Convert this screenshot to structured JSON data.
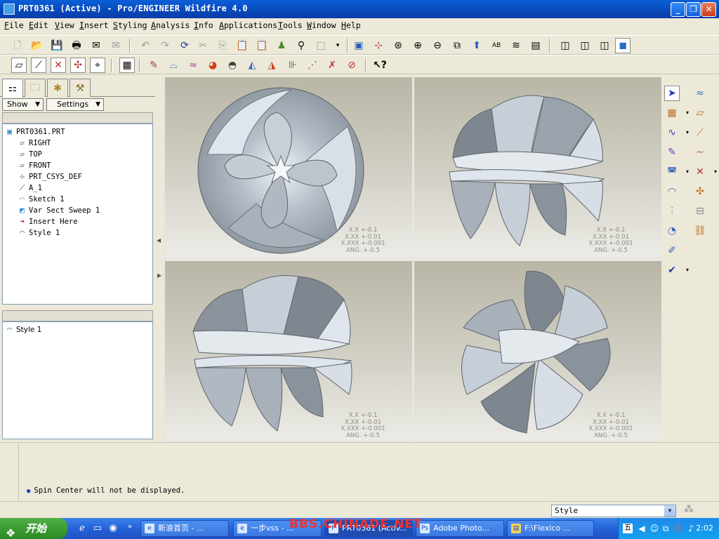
{
  "window": {
    "title": "PRT0361 (Active) - Pro/ENGINEER Wildfire 4.0"
  },
  "menubar": {
    "items": [
      "File",
      "Edit",
      "View",
      "Insert",
      "Styling",
      "Analysis",
      "Info",
      "Applications",
      "Tools",
      "Window",
      "Help"
    ]
  },
  "navigator": {
    "tabs": [
      "model-tree-icon",
      "folder-browser-icon",
      "favorites-icon",
      "connections-icon"
    ],
    "show_label": "Show",
    "settings_label": "Settings",
    "tree": [
      {
        "label": "PRT0361.PRT",
        "icon": "part-icon"
      },
      {
        "label": "RIGHT",
        "icon": "datum-plane-icon"
      },
      {
        "label": "TOP",
        "icon": "datum-plane-icon"
      },
      {
        "label": "FRONT",
        "icon": "datum-plane-icon"
      },
      {
        "label": "PRT_CSYS_DEF",
        "icon": "csys-icon"
      },
      {
        "label": "A_1",
        "icon": "axis-icon"
      },
      {
        "label": "Sketch 1",
        "icon": "sketch-icon"
      },
      {
        "label": "Var Sect Sweep 1",
        "icon": "sweep-icon"
      },
      {
        "label": "Insert Here",
        "icon": "insert-arrow-icon"
      },
      {
        "label": "Style 1",
        "icon": "style-feature-icon"
      }
    ],
    "style_tree": [
      {
        "label": "Style 1",
        "icon": "style-feature-icon"
      }
    ]
  },
  "viewport": {
    "tolerance": [
      "X.X +-0.1",
      "X.XX +-0.01",
      "X.XXX +-0.001",
      "ANG. +-0.5"
    ],
    "views": [
      "top",
      "front",
      "side",
      "isometric"
    ],
    "surface_colors": {
      "light": "#c9d1da",
      "dark": "#7e8790",
      "highlight": "#eef2f6"
    }
  },
  "message": {
    "text": "Spin Center will not be displayed."
  },
  "statusbar": {
    "filter_value": "Style"
  },
  "taskbar": {
    "start_label": "开始",
    "tasks": [
      {
        "label": "新浪首页 - ...",
        "active": false
      },
      {
        "label": "一步vss - ...",
        "active": false
      },
      {
        "label": "PRT0361 (Activ...",
        "active": true
      },
      {
        "label": "Adobe Photo...",
        "active": false
      },
      {
        "label": "F:\\Flexico ...",
        "active": false
      }
    ],
    "watermark": "BBS.CHINADE.NET",
    "clock": "2:02"
  },
  "colors": {
    "titlebar": "#0a5fd8",
    "chrome": "#ece9d8",
    "taskbar": "#2562d8",
    "start": "#3a9a32"
  }
}
